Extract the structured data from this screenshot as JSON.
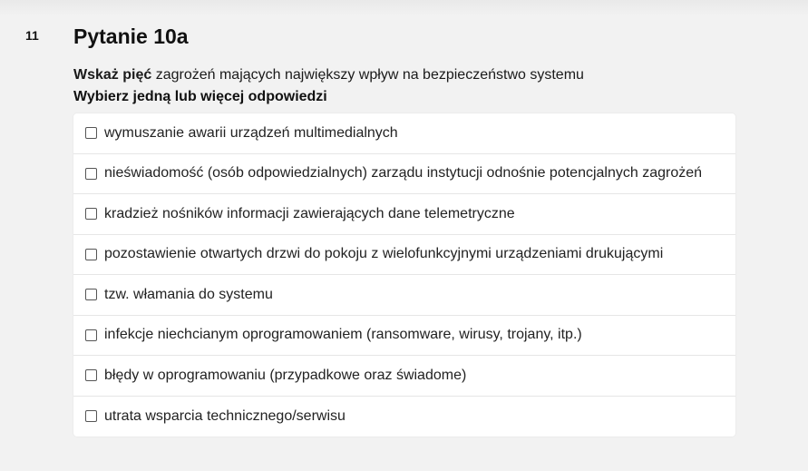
{
  "question": {
    "number": "11",
    "title": "Pytanie 10a",
    "prompt_bold": "Wskaż pięć",
    "prompt_rest": " zagrożeń mających największy wpływ na bezpieczeństwo systemu",
    "instruction": "Wybierz jedną lub więcej odpowiedzi"
  },
  "options": [
    {
      "label": "wymuszanie awarii urządzeń multimedialnych",
      "checked": false
    },
    {
      "label": "nieświadomość (osób odpowiedzialnych) zarządu instytucji odnośnie potencjalnych zagrożeń",
      "checked": false
    },
    {
      "label": "kradzież nośników informacji zawierających dane telemetryczne",
      "checked": false
    },
    {
      "label": "pozostawienie otwartych drzwi do pokoju z wielofunkcyjnymi urządzeniami drukującymi",
      "checked": false
    },
    {
      "label": "tzw. włamania do systemu",
      "checked": false
    },
    {
      "label": "infekcje niechcianym oprogramowaniem (ransomware, wirusy, trojany, itp.)",
      "checked": false
    },
    {
      "label": "błędy w oprogramowaniu (przypadkowe oraz świadome)",
      "checked": false
    },
    {
      "label": "utrata wsparcia technicznego/serwisu",
      "checked": false
    }
  ]
}
